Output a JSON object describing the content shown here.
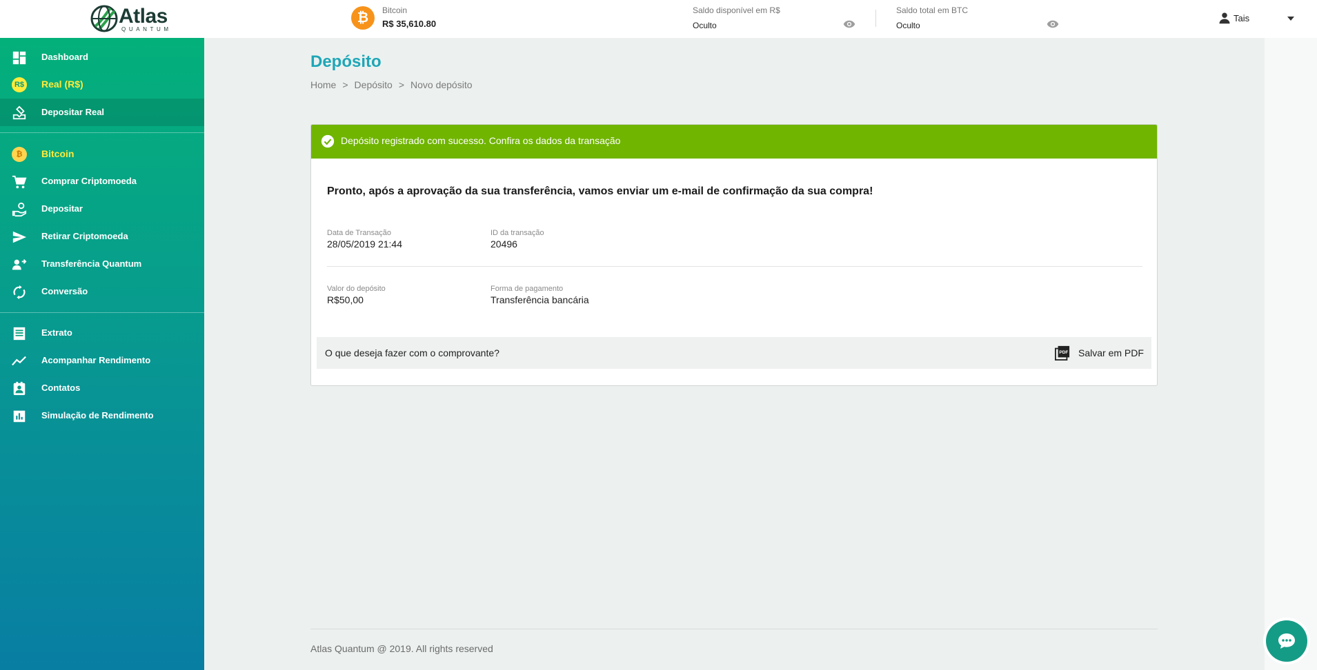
{
  "app": {
    "logo_text": "Atlas",
    "logo_subtext": "QUANTUM"
  },
  "header": {
    "ticker": {
      "icon": "bitcoin-icon",
      "label": "Bitcoin",
      "value": "R$ 35,610.80"
    },
    "balance_brl": {
      "label": "Saldo disponível em R$",
      "value": "Oculto",
      "icon": "eye-icon"
    },
    "balance_btc": {
      "label": "Saldo total em BTC",
      "value": "Oculto",
      "icon": "eye-icon"
    },
    "user": {
      "name": "Tais",
      "icon": "person-icon"
    }
  },
  "sidebar": {
    "items": [
      {
        "label": "Dashboard",
        "icon": "dashboard-icon"
      },
      {
        "label": "Real (R$)",
        "icon": "real-coin-icon",
        "coin_text": "R$"
      },
      {
        "label": "Depositar Real",
        "icon": "deposit-real-icon",
        "active": true
      },
      {
        "label": "Bitcoin",
        "icon": "bitcoin-coin-icon",
        "coin_text": "₿"
      },
      {
        "label": "Comprar Criptomoeda",
        "icon": "cart-icon"
      },
      {
        "label": "Depositar",
        "icon": "hand-coin-icon"
      },
      {
        "label": "Retirar Criptomoeda",
        "icon": "send-icon"
      },
      {
        "label": "Transferência Quantum",
        "icon": "user-transfer-icon"
      },
      {
        "label": "Conversão",
        "icon": "sync-icon"
      },
      {
        "label": "Extrato",
        "icon": "statement-icon"
      },
      {
        "label": "Acompanhar Rendimento",
        "icon": "trending-icon"
      },
      {
        "label": "Contatos",
        "icon": "contacts-icon"
      },
      {
        "label": "Simulação de Rendimento",
        "icon": "bar-chart-icon"
      }
    ]
  },
  "page": {
    "title": "Depósito",
    "breadcrumb": [
      "Home",
      "Depósito",
      "Novo depósito"
    ],
    "breadcrumb_sep": ">"
  },
  "card": {
    "alert": "Depósito registrado com sucesso. Confira os dados da transação",
    "message": "Pronto, após a aprovação da sua transferência, vamos enviar um e-mail de confirmação da sua compra!",
    "fields": [
      {
        "label": "Data de Transação",
        "value": "28/05/2019 21:44"
      },
      {
        "label": "ID da transação",
        "value": "20496"
      },
      {
        "label": "Valor do depósito",
        "value": "R$50,00"
      },
      {
        "label": "Forma de pagamento",
        "value": "Transferência bancária"
      }
    ],
    "receipt_question": "O que deseja fazer com o comprovante?",
    "pdf_button": "Salvar em PDF",
    "pdf_icon_text": "PDF"
  },
  "footer": {
    "text": "Atlas Quantum @ 2019. All rights reserved"
  },
  "colors": {
    "accent_title": "#1fa6b7",
    "success": "#70b500",
    "sidebar_top": "#04b07a",
    "sidebar_bottom": "#087ea3",
    "highlight": "#ffeb3b",
    "bitcoin": "#f7931a"
  }
}
